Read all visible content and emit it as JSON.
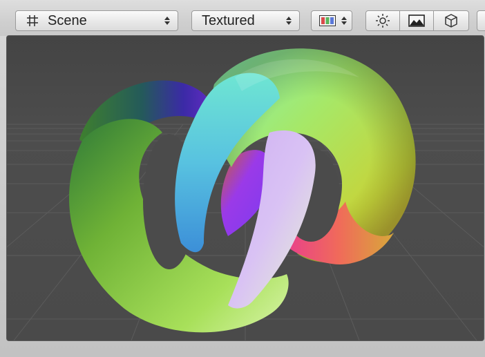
{
  "toolbar": {
    "draw_mode": {
      "icon": "grid-icon",
      "label": "Scene"
    },
    "render_mode": {
      "label": "Textured"
    },
    "color_mode": {
      "icon": "rgb-swatch-icon"
    },
    "toggles": [
      {
        "name": "lighting",
        "icon": "sun-icon"
      },
      {
        "name": "image-effects",
        "icon": "image-icon"
      },
      {
        "name": "gizmos",
        "icon": "cube-icon"
      }
    ]
  },
  "viewport": {
    "background": "#474747",
    "grid_color": "#5a5a5a",
    "content": "knot-mesh"
  }
}
